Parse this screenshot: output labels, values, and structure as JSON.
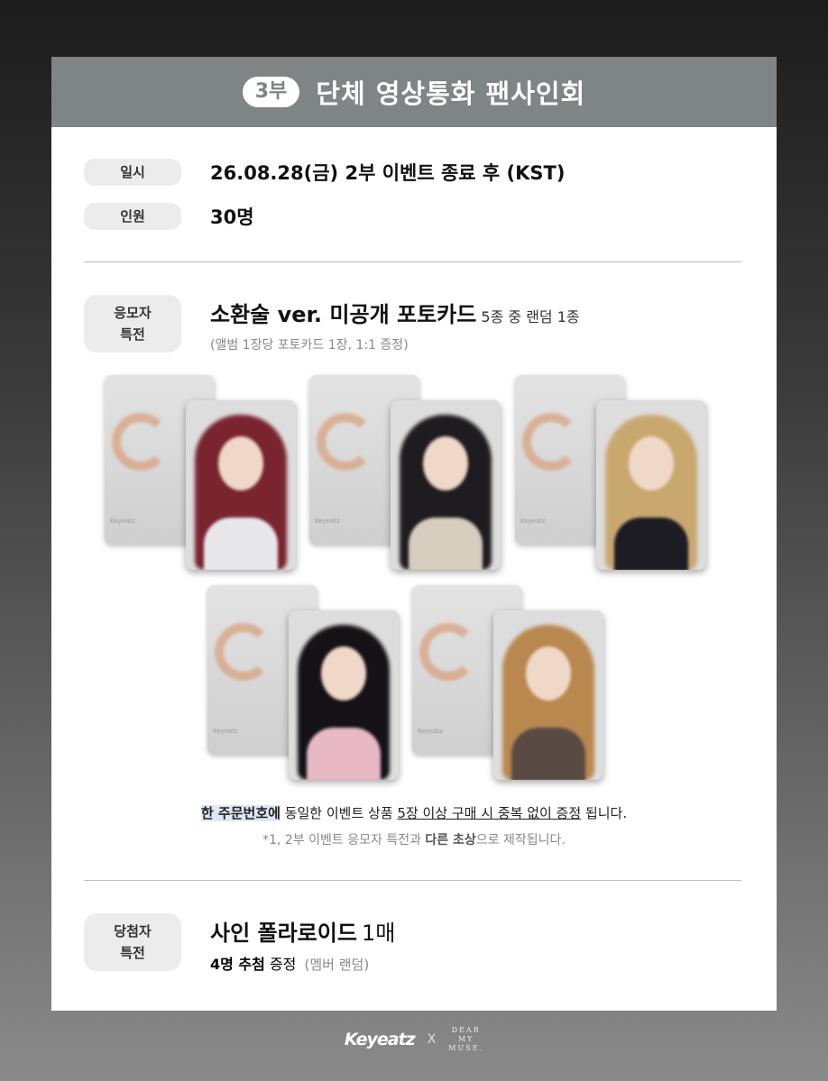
{
  "header": {
    "part": "3부",
    "title": "단체 영상통화 팬사인회"
  },
  "info": [
    {
      "label": "일시",
      "value": "26.08.28(금) 2부 이벤트 종료 후 (KST)"
    },
    {
      "label": "인원",
      "value": "30명"
    }
  ],
  "applicant_benefit": {
    "label_line1": "응모자",
    "label_line2": "특전",
    "title": "소환술 ver. 미공개 포토카드",
    "title_suffix": "5종 중 랜덤 1종",
    "sub": "(앨범 1장당 포토카드 1장, 1:1 증정)",
    "card_brand": "Keyeatz",
    "note_a": "한 주문번호에",
    "note_b": " 동일한 이벤트 상품 ",
    "note_c": "5장 이상 구매 시 중복 없이 증정",
    "note_d": " 됩니다.",
    "note2_a": "*1, 2부 이벤트 응모자 특전과 ",
    "note2_b": "다른 초상",
    "note2_c": "으로 제작됩니다."
  },
  "winner_benefit": {
    "label_line1": "당첨자",
    "label_line2": "특전",
    "title": "사인 폴라로이드",
    "title_suffix": "1매",
    "sub_bold": "4명 추첨",
    "sub_normal": " 증정",
    "sub_gray": "(멤버 랜덤)"
  },
  "photocards": [
    {
      "name": "member-1",
      "hair": "#7a2430",
      "shirt": "#e8e8ea"
    },
    {
      "name": "member-2",
      "hair": "#1e1c20",
      "shirt": "#d7cdbf"
    },
    {
      "name": "member-3",
      "hair": "#c9a870",
      "shirt": "#1c1c22"
    },
    {
      "name": "member-4",
      "hair": "#141216",
      "shirt": "#e7b9c4"
    },
    {
      "name": "member-5",
      "hair": "#b9884f",
      "shirt": "#5a4a44"
    }
  ],
  "footer": {
    "brand": "Keyeatz",
    "x": "X",
    "partner_1": "DEAR",
    "partner_2": "MY",
    "partner_3": "MUSE."
  }
}
